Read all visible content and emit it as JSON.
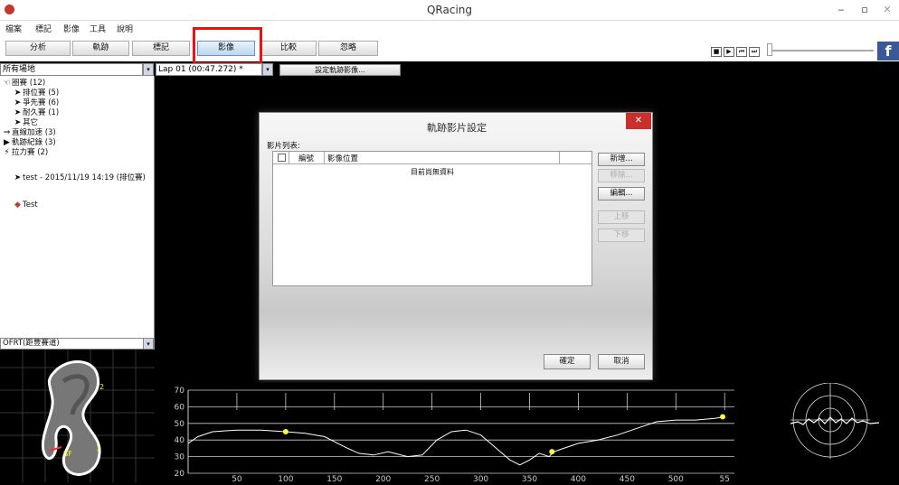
{
  "window": {
    "title": "QRacing",
    "minimize": "‒",
    "maximize": "▫",
    "close": "✕"
  },
  "menu": [
    "檔案",
    "標記",
    "影像",
    "工具",
    "說明"
  ],
  "toolbar": {
    "buttons": [
      "分析",
      "軌跡",
      "標記",
      "影像",
      "比較",
      "忽略"
    ],
    "active": "影像",
    "player": [
      "■",
      "▶",
      "⏮",
      "⏭"
    ],
    "facebook": "f"
  },
  "filters": {
    "venue": "所有場地",
    "lap": "Lap 01  (00:47.272) *",
    "set_track_image_btn": "設定軌跡影像..."
  },
  "sidebar": {
    "items": [
      {
        "icon": "☜",
        "label": "圈賽 (12)"
      },
      {
        "icon": "➤",
        "label": "排位賽 (5)"
      },
      {
        "icon": "➤",
        "label": "爭先賽 (6)"
      },
      {
        "icon": "➤",
        "label": "耐久賽 (1)"
      },
      {
        "icon": "➤",
        "label": "其它"
      },
      {
        "icon": "⇒",
        "label": "直線加速 (3)"
      },
      {
        "icon": "▶",
        "label": "軌跡紀錄 (3)"
      },
      {
        "icon": "⚡",
        "label": "拉力賽 (2)"
      }
    ],
    "session": "test - 2015/11/19 14:19 (排位賽)",
    "marker": "Test"
  },
  "track": {
    "name": "OFRT(距豐賽道)",
    "labels": [
      "2",
      "SF",
      "1"
    ]
  },
  "dialog": {
    "title": "軌跡影片設定",
    "close": "✕",
    "list_label": "影片列表:",
    "columns": [
      "編號",
      "影像位置"
    ],
    "empty": "目前尚無資料",
    "buttons": [
      "新增...",
      "移除...",
      "編輯...",
      "上移",
      "下移"
    ],
    "disabled": [
      "移除...",
      "上移",
      "下移"
    ],
    "ok": "確定",
    "cancel": "取消"
  },
  "chart_data": {
    "type": "line",
    "title": "",
    "xlabel": "",
    "ylabel": "",
    "xlim": [
      0,
      560
    ],
    "ylim": [
      20,
      70
    ],
    "xticks": [
      50,
      100,
      150,
      200,
      250,
      300,
      350,
      400,
      450,
      500,
      550
    ],
    "xtick_labels": [
      "50",
      "100",
      "150",
      "200",
      "250",
      "300",
      "350",
      "400",
      "450",
      "500",
      "55"
    ],
    "yticks": [
      20,
      30,
      40,
      50,
      60,
      70
    ],
    "series": [
      {
        "x": [
          0,
          10,
          25,
          50,
          75,
          100,
          120,
          140,
          160,
          175,
          190,
          205,
          225,
          240,
          255,
          270,
          285,
          300,
          310,
          320,
          330,
          340,
          350,
          360,
          370,
          375,
          385,
          400,
          420,
          440,
          460,
          480,
          500,
          520,
          540,
          550
        ],
        "y": [
          38,
          42,
          45,
          46,
          46,
          45,
          44,
          42,
          36,
          32,
          31,
          33,
          30,
          31,
          40,
          45,
          46,
          43,
          38,
          33,
          28,
          25,
          28,
          32,
          30,
          33,
          35,
          38,
          40,
          43,
          47,
          51,
          52,
          52,
          53,
          54
        ]
      }
    ],
    "markers": [
      {
        "x": 100,
        "y": 45
      },
      {
        "x": 373,
        "y": 33
      },
      {
        "x": 548,
        "y": 54
      }
    ],
    "line_color": "#ffffff",
    "marker_color": "#ffff33",
    "grid": true
  },
  "colors": {
    "highlight": "#ee1111",
    "dialog_close": "#c9302c",
    "facebook": "#3b5998"
  }
}
